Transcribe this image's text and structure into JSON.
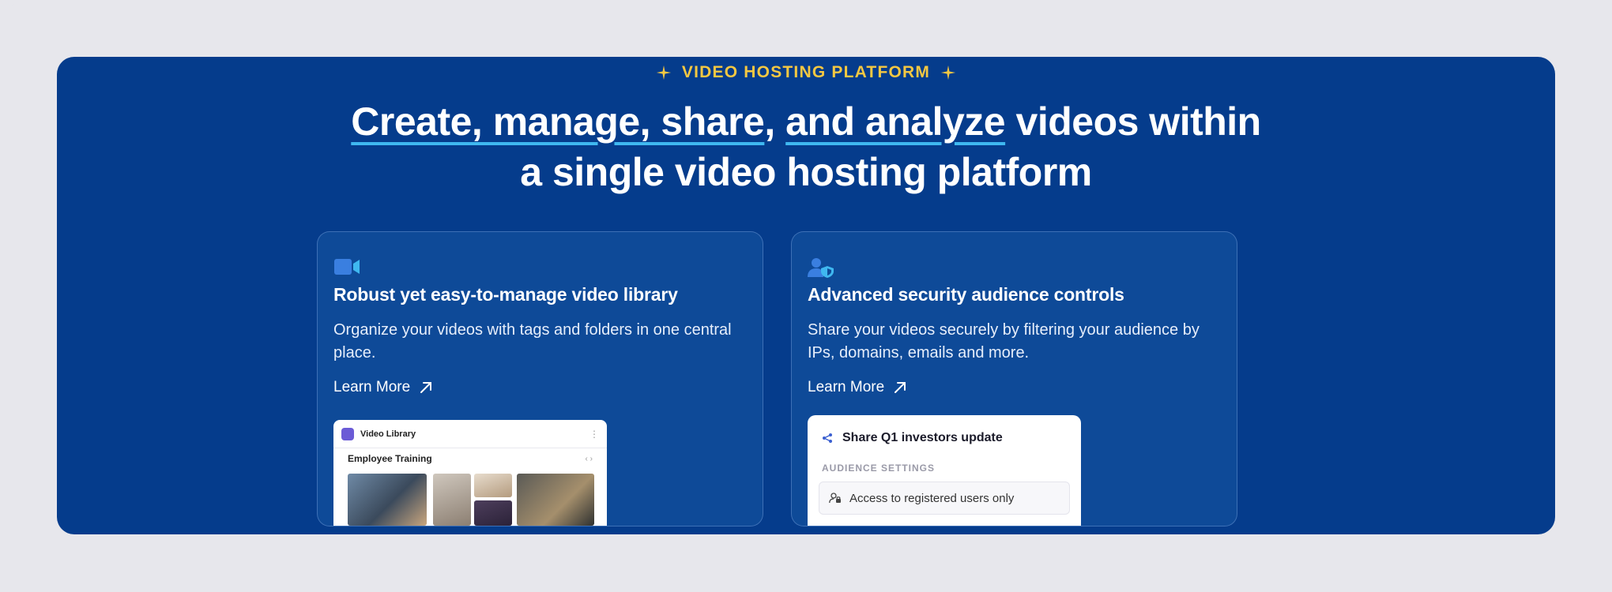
{
  "hero": {
    "eyebrow": "VIDEO HOSTING PLATFORM",
    "headline_u1": "Create, manage, share",
    "headline_comma": ",",
    "headline_u2": "and analyze",
    "headline_rest1": " videos within",
    "headline_line2": "a single video hosting platform"
  },
  "cards": [
    {
      "icon": "video-camera-icon",
      "title": "Robust yet easy-to-manage video library",
      "desc": "Organize your videos with tags and folders in one central place.",
      "link": "Learn More",
      "preview": {
        "app_title": "Video Library",
        "section": "Employee Training",
        "menu": "⋮",
        "nav": "‹ ›"
      }
    },
    {
      "icon": "user-shield-icon",
      "title": "Advanced security audience controls",
      "desc": "Share your videos securely by filtering your audience  by IPs, domains, emails and more.",
      "link": "Learn More",
      "preview": {
        "title": "Share Q1 investors update",
        "label": "AUDIENCE SETTINGS",
        "option": "Access to registered users only"
      }
    }
  ],
  "colors": {
    "background": "#e7e7ec",
    "panel": "#053c8c",
    "accent_yellow": "#f5c842",
    "underline_blue": "#3fb8f0"
  }
}
